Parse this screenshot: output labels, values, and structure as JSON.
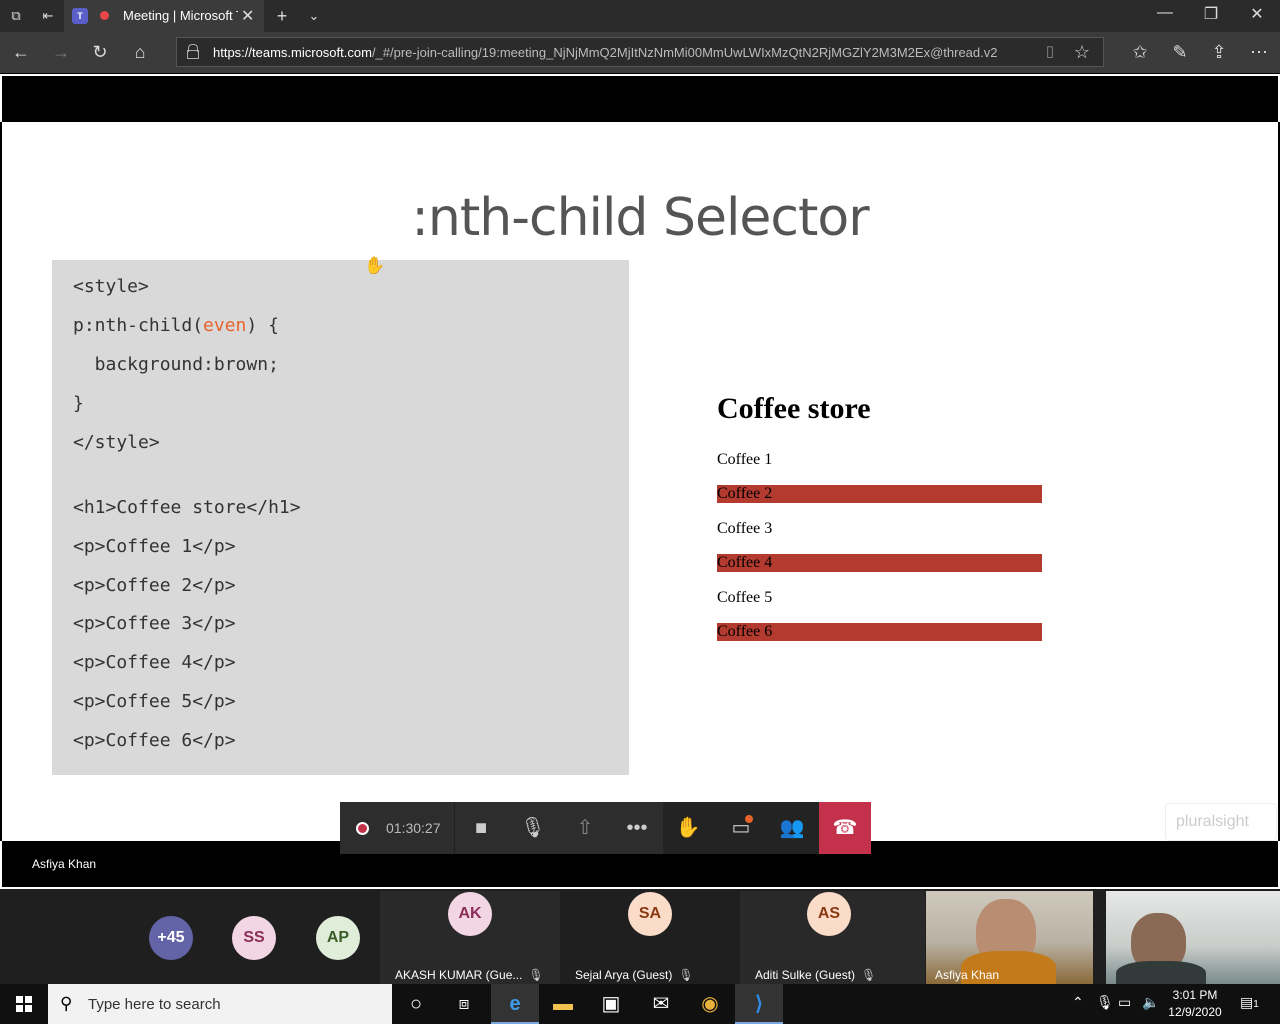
{
  "browser": {
    "tab_title": "Meeting | Microsoft Teams",
    "url_host": "https://teams.microsoft.com",
    "url_path": "/_#/pre-join-calling/19:meeting_NjNjMmQ2MjItNzNmMi00MmUwLWIxMzQtN2RjMGZlY2M3M2Ex@thread.v2"
  },
  "slide": {
    "title": ":nth-child Selector",
    "code": {
      "line1": "<style>",
      "line2_pre": "p:nth-child(",
      "line2_kw": "even",
      "line2_post": ") {",
      "line3": "  background:brown;",
      "line4": "}",
      "line5": "</style>",
      "line6": "<h1>Coffee store</h1>",
      "line7": "<p>Coffee 1</p>",
      "line8": "<p>Coffee 2</p>",
      "line9": "<p>Coffee 3</p>",
      "line10": "<p>Coffee 4</p>",
      "line11": "<p>Coffee 5</p>",
      "line12": "<p>Coffee 6</p>"
    },
    "demo": {
      "heading": "Coffee store",
      "items": [
        "Coffee 1",
        "Coffee 2",
        "Coffee 3",
        "Coffee 4",
        "Coffee 5",
        "Coffee 6"
      ],
      "even_color": "#b23a2e"
    },
    "watermark": "pluralsight"
  },
  "presenter": "Asfiya Khan",
  "call": {
    "timer": "01:30:27",
    "hangup_color": "#c4314b"
  },
  "participants": {
    "overflow": "+45",
    "avatars": [
      {
        "initials": "SS"
      },
      {
        "initials": "AP"
      }
    ],
    "tiles": [
      {
        "initials": "AK",
        "name": "AKASH KUMAR (Gue..."
      },
      {
        "initials": "SA",
        "name": "Sejal Arya (Guest)"
      },
      {
        "initials": "AS",
        "name": "Aditi Sulke (Guest)"
      }
    ],
    "video_name": "Asfiya Khan"
  },
  "taskbar": {
    "search_placeholder": "Type here to search",
    "time": "3:01 PM",
    "date": "12/9/2020",
    "notifications": "1"
  }
}
